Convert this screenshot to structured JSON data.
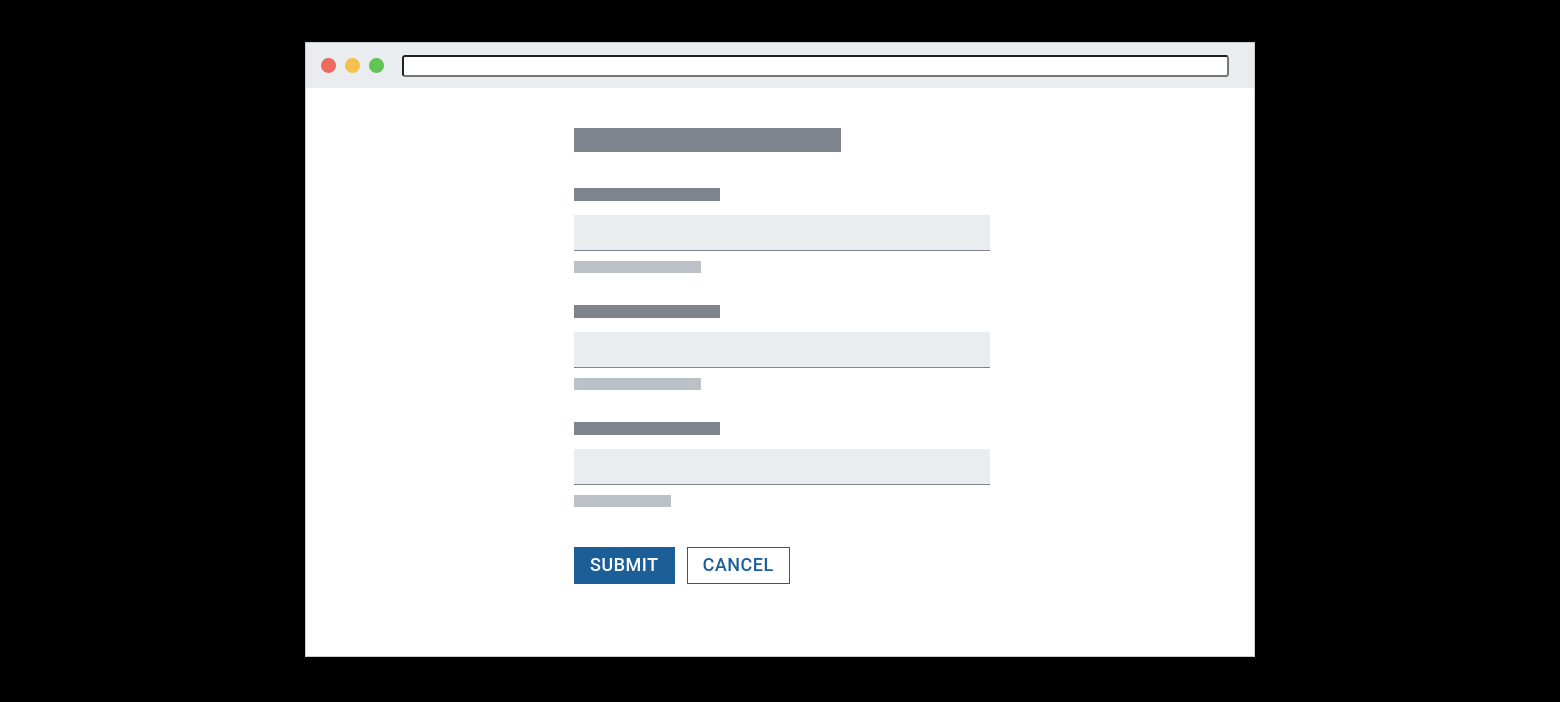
{
  "browser": {
    "address_value": ""
  },
  "form": {
    "title_placeholder_width": 267,
    "fields": [
      {
        "label_width": 146,
        "input_value": "",
        "help_width": 127
      },
      {
        "label_width": 146,
        "input_value": "",
        "help_width": 127
      },
      {
        "label_width": 146,
        "input_value": "",
        "help_width": 97
      }
    ],
    "buttons": {
      "submit_label": "SUBMIT",
      "cancel_label": "CANCEL"
    }
  },
  "colors": {
    "chrome_bg": "#eaedef",
    "placeholder_dark": "#7d848e",
    "placeholder_light": "#bcc1c7",
    "primary": "#1c5e98",
    "traffic_red": "#ed6a5e",
    "traffic_yellow": "#f5bf4f",
    "traffic_green": "#61c554"
  }
}
